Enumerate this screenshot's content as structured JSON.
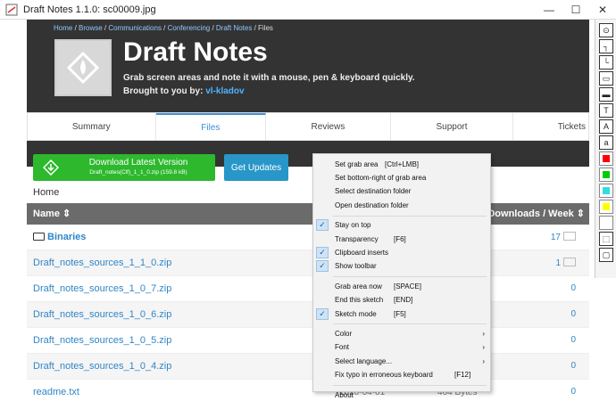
{
  "window": {
    "title": "Draft Notes 1.1.0: sc00009.jpg",
    "min": "—",
    "max": "☐",
    "close": "✕"
  },
  "breadcrumb": {
    "items": [
      "Home",
      "Browse",
      "Communications",
      "Conferencing",
      "Draft Notes"
    ],
    "current": "Files",
    "sep": " / "
  },
  "project": {
    "title": "Draft Notes",
    "tagline": "Grab screen areas and note it with a mouse, pen & keyboard quickly.",
    "brought_prefix": "Brought to you by: ",
    "author": "vl-kladov"
  },
  "tabs": [
    {
      "label": "Summary",
      "active": false
    },
    {
      "label": "Files",
      "active": true
    },
    {
      "label": "Reviews",
      "active": false
    },
    {
      "label": "Support",
      "active": false
    },
    {
      "label": "Tickets",
      "active": false
    }
  ],
  "download": {
    "main": "Download Latest Version",
    "sub": "Draft_notes(Clf)_1_1_0.zip (159.8 kB)"
  },
  "updates_label": "Get Updates",
  "home_label": "Home",
  "table": {
    "col_name": "Name",
    "col_downloads": "Downloads / Week",
    "rows": [
      {
        "name": "Binaries",
        "folder": true,
        "downloads": "17",
        "date": "",
        "size": ""
      },
      {
        "name": "Draft_notes_sources_1_1_0.zip",
        "folder": false,
        "downloads": "1",
        "date": "",
        "size": ""
      },
      {
        "name": "Draft_notes_sources_1_0_7.zip",
        "folder": false,
        "downloads": "0",
        "date": "",
        "size": ""
      },
      {
        "name": "Draft_notes_sources_1_0_6.zip",
        "folder": false,
        "downloads": "0",
        "date": "",
        "size": ""
      },
      {
        "name": "Draft_notes_sources_1_0_5.zip",
        "folder": false,
        "downloads": "0",
        "date": "",
        "size": ""
      },
      {
        "name": "Draft_notes_sources_1_0_4.zip",
        "folder": false,
        "downloads": "0",
        "date": "",
        "size": ""
      },
      {
        "name": "readme.txt",
        "folder": false,
        "downloads": "0",
        "date": "2020-04-01",
        "size": "464 Bytes"
      }
    ]
  },
  "menu": {
    "items": [
      {
        "label": "Set grab area",
        "key": "[Ctrl+LMB]",
        "checked": false,
        "submenu": false
      },
      {
        "label": "Set bottom-right of grab area",
        "key": "",
        "checked": false,
        "submenu": false
      },
      {
        "label": "Select destination folder",
        "key": "",
        "checked": false,
        "submenu": false
      },
      {
        "label": "Open destination folder",
        "key": "",
        "checked": false,
        "submenu": false
      },
      {
        "sep": true
      },
      {
        "label": "Stay on top",
        "key": "",
        "checked": true,
        "submenu": false
      },
      {
        "label": "Transparency",
        "key": "[F6]",
        "checked": false,
        "submenu": false
      },
      {
        "label": "Clipboard inserts",
        "key": "",
        "checked": true,
        "submenu": false
      },
      {
        "label": "Show toolbar",
        "key": "",
        "checked": true,
        "submenu": false
      },
      {
        "sep": true
      },
      {
        "label": "Grab area now",
        "key": "[SPACE]",
        "checked": false,
        "submenu": false
      },
      {
        "label": "End this sketch",
        "key": "[END]",
        "checked": false,
        "submenu": false
      },
      {
        "label": "Sketch mode",
        "key": "[F5]",
        "checked": true,
        "submenu": false
      },
      {
        "sep": true
      },
      {
        "label": "Color",
        "key": "",
        "checked": false,
        "submenu": true
      },
      {
        "label": "Font",
        "key": "",
        "checked": false,
        "submenu": true
      },
      {
        "label": "Select language...",
        "key": "",
        "checked": false,
        "submenu": true
      },
      {
        "label": "Fix typo in erroneous keyboard",
        "key": "[F12]",
        "checked": false,
        "submenu": false
      },
      {
        "sep": true
      },
      {
        "label": "About",
        "key": "",
        "checked": false,
        "submenu": false
      }
    ]
  },
  "toolbar": {
    "tools": [
      {
        "name": "camera-icon",
        "glyph": "⊙"
      },
      {
        "name": "line-step-icon",
        "glyph": "┐"
      },
      {
        "name": "line-step2-icon",
        "glyph": "└"
      },
      {
        "name": "rectangle-icon",
        "glyph": "▭"
      },
      {
        "name": "filled-rect-icon",
        "glyph": "▬"
      },
      {
        "name": "text-icon",
        "glyph": "T"
      },
      {
        "name": "text-italic-icon",
        "glyph": "A"
      },
      {
        "name": "text-small-icon",
        "glyph": "a"
      }
    ],
    "colors": [
      "#ff0000",
      "#00cc00",
      "#33dddd",
      "#ffff00",
      "#ffffff"
    ],
    "bottom": [
      {
        "name": "frame-icon",
        "glyph": "⬚"
      },
      {
        "name": "frame2-icon",
        "glyph": "▢"
      }
    ]
  }
}
